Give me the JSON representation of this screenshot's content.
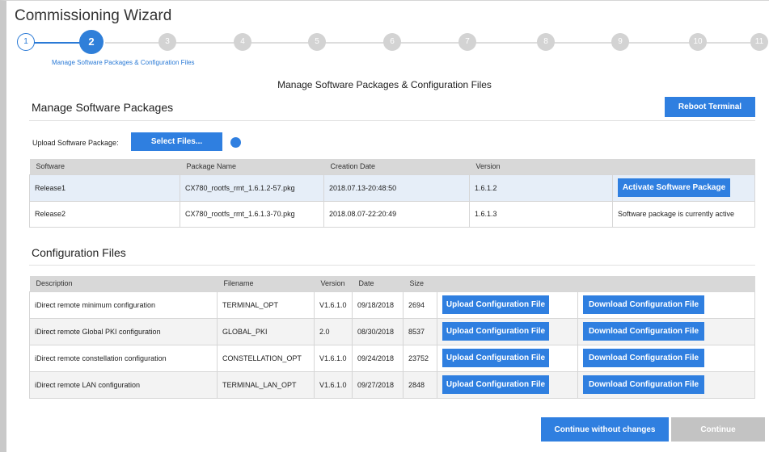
{
  "wizard": {
    "title": "Commissioning Wizard",
    "steps": [
      "1",
      "2",
      "3",
      "4",
      "5",
      "6",
      "7",
      "8",
      "9",
      "10",
      "11"
    ],
    "active_step_caption": "Manage Software Packages & Configuration Files"
  },
  "page_heading": "Manage Software Packages & Configuration Files",
  "software": {
    "title": "Manage Software Packages",
    "reboot_label": "Reboot Terminal",
    "upload_label": "Upload Software Package:",
    "select_files_label": "Select Files...",
    "columns": [
      "Software",
      "Package Name",
      "Creation Date",
      "Version"
    ],
    "rows": [
      {
        "software": "Release1",
        "package": "CX780_rootfs_rmt_1.6.1.2-57.pkg",
        "date": "2018.07.13-20:48:50",
        "version": "1.6.1.2",
        "action": "Activate Software Package"
      },
      {
        "software": "Release2",
        "package": "CX780_rootfs_rmt_1.6.1.3-70.pkg",
        "date": "2018.08.07-22:20:49",
        "version": "1.6.1.3",
        "status": "Software package is currently active"
      }
    ]
  },
  "config": {
    "title": "Configuration Files",
    "columns": [
      "Description",
      "Filename",
      "Version",
      "Date",
      "Size"
    ],
    "upload_label": "Upload Configuration File",
    "download_label": "Download Configuration File",
    "rows": [
      {
        "description": "iDirect remote minimum configuration",
        "filename": "TERMINAL_OPT",
        "version": "V1.6.1.0",
        "date": "09/18/2018",
        "size": "2694"
      },
      {
        "description": "iDirect remote Global PKI configuration",
        "filename": "GLOBAL_PKI",
        "version": "2.0",
        "date": "08/30/2018",
        "size": "8537"
      },
      {
        "description": "iDirect remote constellation configuration",
        "filename": "CONSTELLATION_OPT",
        "version": "V1.6.1.0",
        "date": "09/24/2018",
        "size": "23752"
      },
      {
        "description": "iDirect remote LAN configuration",
        "filename": "TERMINAL_LAN_OPT",
        "version": "V1.6.1.0",
        "date": "09/27/2018",
        "size": "2848"
      }
    ]
  },
  "footer": {
    "continue_without_label": "Continue without changes",
    "continue_label": "Continue"
  },
  "colors": {
    "accent": "#2f7fe0",
    "disabled": "#c3c3c3",
    "row_highlight": "#e6eef8"
  }
}
